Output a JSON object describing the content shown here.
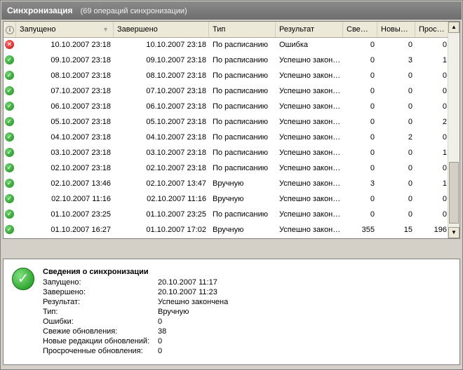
{
  "header": {
    "title": "Синхронизация",
    "subtitle": "(69 операций синхронизации)"
  },
  "columns": [
    "Запущено",
    "Завершено",
    "Тип",
    "Результат",
    "Све…",
    "Новы…",
    "Прос…"
  ],
  "rows": [
    {
      "status": "error",
      "start": "10.10.2007 23:18",
      "end": "10.10.2007 23:18",
      "type": "По расписанию",
      "result": "Ошибка",
      "fresh": "0",
      "newrev": "0",
      "overdue": "0"
    },
    {
      "status": "ok",
      "start": "09.10.2007 23:18",
      "end": "09.10.2007 23:18",
      "type": "По расписанию",
      "result": "Успешно закон…",
      "fresh": "0",
      "newrev": "3",
      "overdue": "1"
    },
    {
      "status": "ok",
      "start": "08.10.2007 23:18",
      "end": "08.10.2007 23:18",
      "type": "По расписанию",
      "result": "Успешно закон…",
      "fresh": "0",
      "newrev": "0",
      "overdue": "0"
    },
    {
      "status": "ok",
      "start": "07.10.2007 23:18",
      "end": "07.10.2007 23:18",
      "type": "По расписанию",
      "result": "Успешно закон…",
      "fresh": "0",
      "newrev": "0",
      "overdue": "0"
    },
    {
      "status": "ok",
      "start": "06.10.2007 23:18",
      "end": "06.10.2007 23:18",
      "type": "По расписанию",
      "result": "Успешно закон…",
      "fresh": "0",
      "newrev": "0",
      "overdue": "0"
    },
    {
      "status": "ok",
      "start": "05.10.2007 23:18",
      "end": "05.10.2007 23:18",
      "type": "По расписанию",
      "result": "Успешно закон…",
      "fresh": "0",
      "newrev": "0",
      "overdue": "2"
    },
    {
      "status": "ok",
      "start": "04.10.2007 23:18",
      "end": "04.10.2007 23:18",
      "type": "По расписанию",
      "result": "Успешно закон…",
      "fresh": "0",
      "newrev": "2",
      "overdue": "0"
    },
    {
      "status": "ok",
      "start": "03.10.2007 23:18",
      "end": "03.10.2007 23:18",
      "type": "По расписанию",
      "result": "Успешно закон…",
      "fresh": "0",
      "newrev": "0",
      "overdue": "1"
    },
    {
      "status": "ok",
      "start": "02.10.2007 23:18",
      "end": "02.10.2007 23:18",
      "type": "По расписанию",
      "result": "Успешно закон…",
      "fresh": "0",
      "newrev": "0",
      "overdue": "0"
    },
    {
      "status": "ok",
      "start": "02.10.2007 13:46",
      "end": "02.10.2007 13:47",
      "type": "Вручную",
      "result": "Успешно закон…",
      "fresh": "3",
      "newrev": "0",
      "overdue": "1"
    },
    {
      "status": "ok",
      "start": "02.10.2007 11:16",
      "end": "02.10.2007 11:16",
      "type": "Вручную",
      "result": "Успешно закон…",
      "fresh": "0",
      "newrev": "0",
      "overdue": "0"
    },
    {
      "status": "ok",
      "start": "01.10.2007 23:25",
      "end": "01.10.2007 23:25",
      "type": "По расписанию",
      "result": "Успешно закон…",
      "fresh": "0",
      "newrev": "0",
      "overdue": "0"
    },
    {
      "status": "ok",
      "start": "01.10.2007 16:27",
      "end": "01.10.2007 17:02",
      "type": "Вручную",
      "result": "Успешно закон…",
      "fresh": "355",
      "newrev": "15",
      "overdue": "196"
    }
  ],
  "details": {
    "title": "Сведения о синхронизации",
    "fields": [
      {
        "label": "Запущено:",
        "value": "20.10.2007 11:17"
      },
      {
        "label": "Завершено:",
        "value": "20.10.2007 11:23"
      },
      {
        "label": "Результат:",
        "value": "Успешно закончена"
      },
      {
        "label": "Тип:",
        "value": "Вручную"
      },
      {
        "label": "Ошибки:",
        "value": "0"
      },
      {
        "label": "Свежие обновления:",
        "value": "38"
      },
      {
        "label": "Новые редакции обновлений:",
        "value": "0"
      },
      {
        "label": "Просроченные обновления:",
        "value": "0"
      }
    ]
  },
  "icons": {
    "ok": "check-circle-icon",
    "error": "x-circle-icon",
    "info": "info-icon"
  },
  "colors": {
    "ok": "#1a8a1a",
    "error": "#c01010",
    "title_bar": "#6e6e6e"
  }
}
